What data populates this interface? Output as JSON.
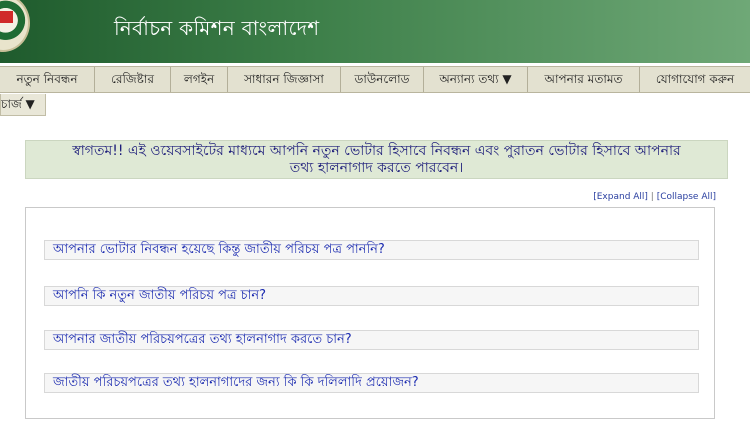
{
  "header": {
    "title": "নির্বাচন কমিশন  বাংলাদেশ"
  },
  "nav": {
    "items": [
      "নতুন নিবন্ধন",
      "রেজিষ্টার",
      "লগইন",
      "সাধারন জিজ্ঞাসা",
      "ডাউনলোড",
      "অন্যান্য তথ্য ▼",
      "আপনার মতামত",
      "যোগাযোগ করুন"
    ]
  },
  "subnav": {
    "label": "চার্জ ▼"
  },
  "welcome": {
    "line1": "স্বাগতম!! এই ওয়েবসাইটের মাধ্যমে আপনি নতুন ভোটার হিসাবে নিবন্ধন এবং পুরাতন ভোটার হিসাবে আপনার",
    "line2": "তথ্য হালনাগাদ করতে পারবেন।"
  },
  "controls": {
    "expand_all": "[Expand All]",
    "separator": " | ",
    "collapse_all": "[Collapse All]"
  },
  "faq": {
    "items": [
      "আপনার ভোটার নিবন্ধন হয়েছে কিন্তু জাতীয় পরিচয় পত্র পাননি?",
      "আপনি কি নতুন জাতীয় পরিচয় পত্র চান?",
      "আপনার জাতীয় পরিচয়পত্রের তথ্য হালনাগাদ করতে চান?",
      "জাতীয় পরিচয়পত্রের তথ্য হালনাগাদের জন্য কি কি দলিলাদি প্রয়োজন?"
    ]
  }
}
